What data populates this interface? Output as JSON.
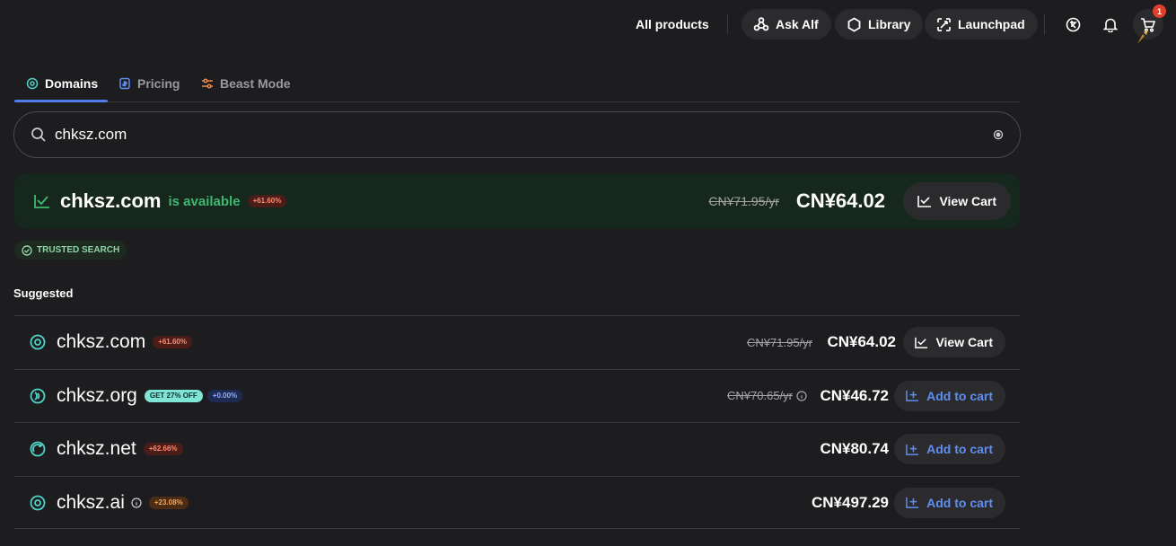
{
  "topbar": {
    "all_products": "All products",
    "ask_alf": "Ask Alf",
    "library": "Library",
    "launchpad": "Launchpad",
    "cart_count": "1",
    "icons": [
      "flag-icon",
      "bell-icon",
      "cart-icon",
      "avatar"
    ]
  },
  "tabs": [
    {
      "label": "Domains",
      "icon": "target-icon",
      "active": true
    },
    {
      "label": "Pricing",
      "icon": "price-tag-icon",
      "active": false
    },
    {
      "label": "Beast Mode",
      "icon": "sliders-icon",
      "active": false
    }
  ],
  "search": {
    "value": "chksz.com",
    "placeholder": ""
  },
  "hero": {
    "domain": "chksz.com",
    "status": "is available",
    "change": "+61.60%",
    "old_price": "CN¥71.95/yr",
    "price": "CN¥64.02",
    "button": "View Cart"
  },
  "trusted_label": "TRUSTED SEARCH",
  "suggested_title": "Suggested",
  "suggestions": [
    {
      "domain": "chksz.com",
      "promo": "",
      "change": "+61.60%",
      "old_price": "CN¥71.95/yr",
      "price": "CN¥64.02",
      "button": "View Cart"
    },
    {
      "domain": "chksz.org",
      "promo": "GET 27% OFF",
      "change": "+0.00%",
      "old_price": "CN¥70.65/yr",
      "price": "CN¥46.72",
      "button": "Add to cart"
    },
    {
      "domain": "chksz.net",
      "promo": "",
      "change": "+62.66%",
      "old_price": "",
      "price": "CN¥80.74",
      "button": "Add to cart"
    },
    {
      "domain": "chksz.ai",
      "promo": "",
      "change": "+23.08%",
      "old_price": "",
      "price": "CN¥497.29",
      "button": "Add to cart"
    }
  ],
  "colors": {
    "background": "#1d1d1f",
    "accent_blue": "#5f8ef0",
    "available_green": "#3fb871",
    "hero_bg": "#16281d"
  }
}
